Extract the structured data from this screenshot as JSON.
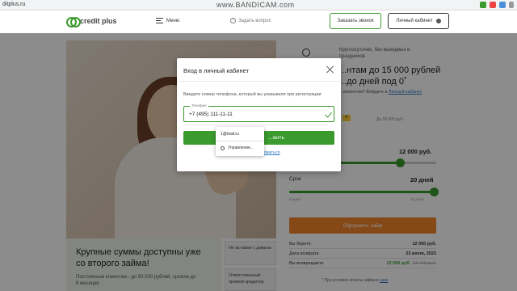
{
  "browser": {
    "url": "ditplus.ru",
    "watermark": "www.BANDICAM.com"
  },
  "header": {
    "logo_primary": "credit",
    "logo_secondary": "plus",
    "menu_label": "Меню",
    "ask_label": "Задать вопрос",
    "call_button": "Заказать звонок",
    "cabinet_button": "Личный кабинет"
  },
  "promo": {
    "title": "Крупные суммы доступны уже со второго займа!",
    "text": "Постоянным клиентам - до 50 000 рублей, сроком до 6 месяцев",
    "badge1": "Не вставая с дивана",
    "badge2": "Ответственный прямой кредитор"
  },
  "calculator": {
    "hours": "Круглосуточно, без выходных и праздников",
    "headline": "...нтам до 15 000 рублей ...до дней под 0˚",
    "login_note_prefix": "...клиентом? Войдите в",
    "login_note_link": "Личный кабинет",
    "tab_selected": "0",
    "tab_other": "До 50 000 руб.",
    "amount_value": "12 000 руб.",
    "amount_fill_fraction": 0.75,
    "term_label": "Срок",
    "term_value": "20 дней",
    "term_fill_fraction": 1.0,
    "term_min": "5 дней",
    "term_max": "20 дней",
    "apply_button": "Оформить займ",
    "rows": [
      {
        "label": "Вы берете",
        "value": "12 000 руб."
      },
      {
        "label": "Дата возврата",
        "value": "23 июля, 2023"
      },
      {
        "label": "Вы возвращаете",
        "value": "12 000 руб.",
        "old_value": "13 440 руб."
      }
    ],
    "footnote_prefix": "* При условии оплаты займа в",
    "footnote_link": "срок"
  },
  "modal": {
    "title": "Вход в личный кабинет",
    "hint": "Введите номер телефона, который вы указывали при регистрации",
    "phone_label": "Телефон",
    "phone_value": "+7 (495) 111-11-11",
    "submit_label": "...жить",
    "forgot_label": "...оваться"
  },
  "autofill": {
    "suggestion": "1@mail.ru",
    "manage": "Управление..."
  },
  "colors": {
    "brand_green": "#3a9a2e",
    "accent_orange": "#f0862a",
    "link_blue": "#2f7ac5"
  }
}
